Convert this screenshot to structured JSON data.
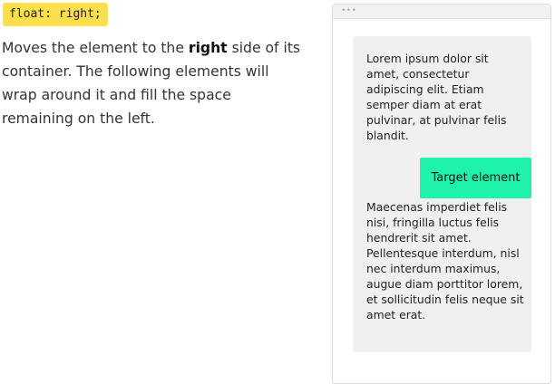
{
  "code_label": "float: right;",
  "description": {
    "before": "Moves the element to the ",
    "emphasis": "right",
    "after": " side of its container. The following elements will wrap around it and fill the space remaining on the left."
  },
  "demo": {
    "window_dots": "•••",
    "paragraph_1": "Lorem ipsum dolor sit amet, consectetur adipiscing elit. Etiam semper diam at erat pulvinar, at pulvinar felis blandit.",
    "target_label": "Target element",
    "paragraph_2": "Maecenas imperdiet felis nisi, fringilla luctus felis hendrerit sit amet. Pellentesque interdum, nisl nec interdum maximus, augue diam porttitor lorem, et sollicitudin felis neque sit amet erat."
  },
  "colors": {
    "code_badge_bg": "#fbe04b",
    "target_bg": "#1ff3ab",
    "container_bg": "#f0f0f0"
  }
}
